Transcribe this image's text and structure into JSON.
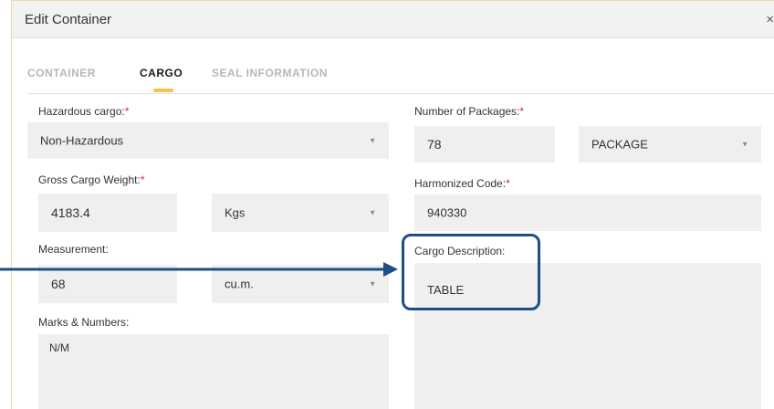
{
  "modal": {
    "title": "Edit Container",
    "close_glyph": "×"
  },
  "tabs": [
    {
      "label": "CONTAINER",
      "active": false
    },
    {
      "label": "CARGO",
      "active": true
    },
    {
      "label": "SEAL INFORMATION",
      "active": false
    }
  ],
  "form": {
    "hazardous": {
      "label": "Hazardous cargo:",
      "required_mark": "*",
      "value": "Non-Hazardous"
    },
    "packages": {
      "label": "Number of Packages:",
      "required_mark": "*",
      "value": "78",
      "unit": "PACKAGE"
    },
    "gross_weight": {
      "label": "Gross Cargo Weight:",
      "required_mark": "*",
      "value": "4183.4",
      "unit": "Kgs"
    },
    "harmonized": {
      "label": "Harmonized Code:",
      "required_mark": "*",
      "value": "940330"
    },
    "measurement": {
      "label": "Measurement:",
      "value": "68",
      "unit": "cu.m."
    },
    "cargo_description": {
      "label": "Cargo Description:",
      "value": "TABLE"
    },
    "marks": {
      "label": "Marks & Numbers:",
      "value": "N/M"
    }
  },
  "icons": {
    "dropdown": "chevron-down-icon",
    "close": "close-icon",
    "annotation": "arrow-icon"
  },
  "colors": {
    "accent_tab": "#f3c352",
    "required": "#d9262b",
    "annotation": "#1e4e8a",
    "field_bg": "#efefef"
  }
}
